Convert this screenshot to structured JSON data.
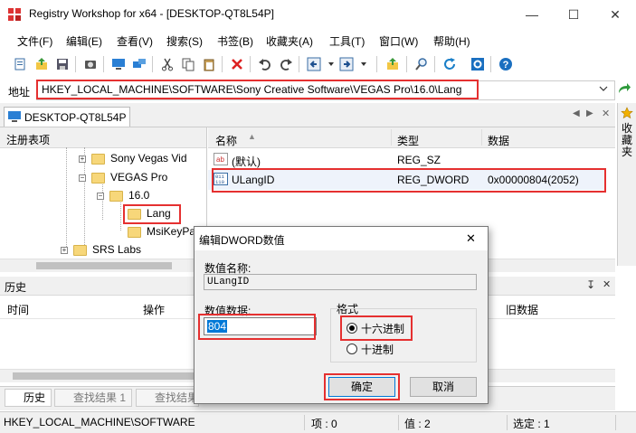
{
  "window": {
    "title": "Registry Workshop for x64 - [DESKTOP-QT8L54P]",
    "minimize_glyph": "—",
    "maximize_glyph": "☐",
    "close_glyph": "✕"
  },
  "menu": [
    "文件(F)",
    "编辑(E)",
    "查看(V)",
    "搜索(S)",
    "书签(B)",
    "收藏夹(A)",
    "工具(T)",
    "窗口(W)",
    "帮助(H)"
  ],
  "toolbar": {
    "icons": [
      "new-icon",
      "import-icon",
      "save-icon",
      "snapshot-icon",
      "computer-icon",
      "network-icon",
      "cut-icon",
      "copy-icon",
      "paste-icon",
      "delete-icon",
      "undo-icon",
      "redo-icon",
      "back-icon",
      "forward-icon",
      "up-level-icon",
      "find-icon",
      "refresh-icon",
      "settings-icon",
      "help-icon"
    ]
  },
  "address": {
    "label": "地址",
    "value": "HKEY_LOCAL_MACHINE\\SOFTWARE\\Sony Creative Software\\VEGAS Pro\\16.0\\Lang"
  },
  "tab": {
    "label": "DESKTOP-QT8L54P"
  },
  "sidebar_right": {
    "label": "收藏夹"
  },
  "tree": {
    "header": "注册表项",
    "items": [
      {
        "label": "Sony Vegas Vid",
        "level": 2
      },
      {
        "label": "VEGAS Pro",
        "level": 2
      },
      {
        "label": "16.0",
        "level": 3
      },
      {
        "label": "Lang",
        "level": 4
      },
      {
        "label": "MsiKeyPa",
        "level": 4
      },
      {
        "label": "SRS Labs",
        "level": 1
      }
    ]
  },
  "list": {
    "columns": [
      "名称",
      "类型",
      "数据"
    ],
    "rows": [
      {
        "name": "(默认)",
        "type": "REG_SZ",
        "data": "",
        "icon": "string-value-icon"
      },
      {
        "name": "ULangID",
        "type": "REG_DWORD",
        "data": "0x00000804(2052)",
        "icon": "dword-value-icon"
      }
    ]
  },
  "history": {
    "title": "历史",
    "columns": [
      "时间",
      "操作",
      "旧数据"
    ],
    "pin_glyph": "↧",
    "close_glyph": "✕"
  },
  "bottom_tabs": [
    "历史",
    "查找结果 1",
    "查找结果"
  ],
  "status": {
    "path": "HKEY_LOCAL_MACHINE\\SOFTWARE",
    "items": "项 : 0",
    "values": "值 : 2",
    "selected": "选定 : 1"
  },
  "dialog": {
    "title": "编辑DWORD数值",
    "name_label": "数值名称:",
    "name_value": "ULangID",
    "data_label": "数值数据:",
    "data_value": "804",
    "format_label": "格式",
    "hex_label": "十六进制",
    "dec_label": "十进制",
    "selected_format": "hex",
    "ok_label": "确定",
    "cancel_label": "取消",
    "close_glyph": "✕"
  },
  "colors": {
    "highlight_red": "#e53030",
    "selection_blue": "#0078d7"
  }
}
